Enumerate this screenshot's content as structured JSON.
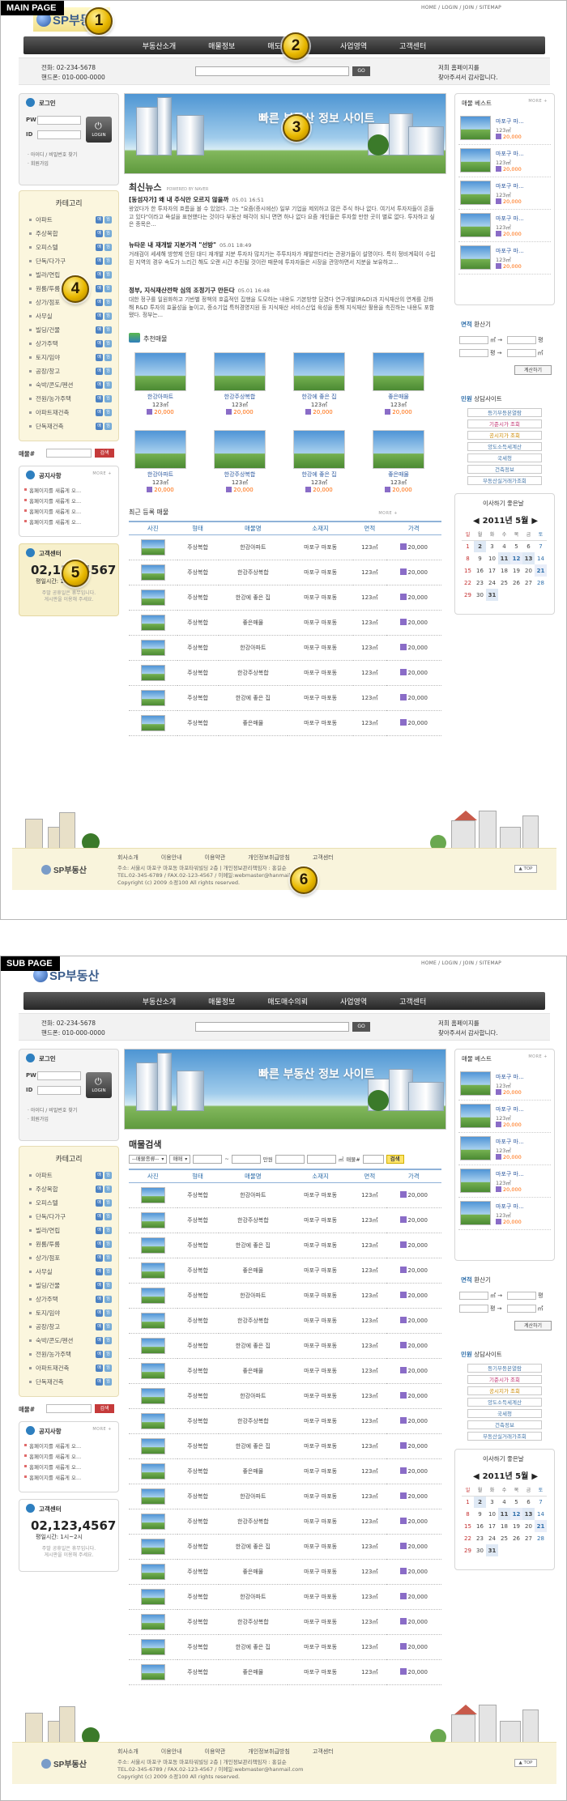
{
  "labels": {
    "main_tag": "MAIN PAGE",
    "sub_tag": "SUB PAGE"
  },
  "markers": [
    "1",
    "2",
    "3",
    "4",
    "5",
    "6"
  ],
  "site": {
    "logo": "SP부동산",
    "util": "HOME / LOGIN / JOIN / SITEMAP",
    "nav": [
      "부동산소개",
      "매물정보",
      "매도매수의뢰",
      "사업영역",
      "고객센터"
    ],
    "tel1": "전화: 02-234-5678",
    "tel2": "핸드폰: 010-000-0000",
    "search_button": "GO",
    "welcome1": "저희 홈페이지를",
    "welcome2": "찾아주셔서 감사합니다."
  },
  "login": {
    "title": "로그인",
    "pw": "PW",
    "id": "ID",
    "button": "LOGIN",
    "link1": "· 아이디 / 비밀번호 찾기",
    "link2": "· 회원가입"
  },
  "category": {
    "title": "카테고리",
    "items": [
      "아파트",
      "주상복합",
      "오피스텔",
      "단독/다가구",
      "빌라/연립",
      "원룸/투룸",
      "상가/점포",
      "사무실",
      "빌딩/건물",
      "상가주택",
      "토지/임야",
      "공장/창고",
      "숙박/콘도/펜션",
      "전원/농가주택",
      "아파트재건축",
      "단독재건축"
    ],
    "icon_a": "매",
    "icon_b": "임"
  },
  "sale": {
    "label": "매물#",
    "button": "검색"
  },
  "notice": {
    "title": "공지사항",
    "more": "MORE +",
    "items": [
      "홈페이지를 새롭게 오...",
      "홈페이지를 새롭게 오...",
      "홈페이지를 새롭게 오...",
      "홈페이지를 새롭게 오..."
    ]
  },
  "cs": {
    "title": "고객센터",
    "phone": "02,123,4567",
    "hours": "평일시간: 1시~2시",
    "note1": "주말 공휴일은 휴무입니다.",
    "note2": "게시판을 이용해 주세요."
  },
  "banner": {
    "title": "빠른 부동산 정보 사이트"
  },
  "news": {
    "title": "최신뉴스",
    "powered": "POWERED BY NAVER",
    "items": [
      {
        "title": "[동섬자가] 왜 내 주식만 오르지 않을까",
        "date": "05.01 16:51",
        "body": "왕었다가 한 투자자의 흐름을 볼 수 있었다. 그는 \"요즘(증시에선) 일부 기업을 제외하고 많은 주식 하나 없다. 여기서 투자자들이 흔들고 있다\"이라고 욕설을 표현했다는 것이다 부동산 매각이 되니 면면 하나 없다 요즘 개인들은 투자할 만한 곳이 별로 없다. 투자하고 싶은 종목은..."
      },
      {
        "title": "뉴타운 내 재개발 지분가격 \"선방\"",
        "date": "05.01 18:49",
        "body": "거래검이 세세해 방향제 안된 대디 재개발 지분 투자자 많지가는 주투자자가 재발한다라는 관광가들이 설명이다. 특히 정비계획이 수립된 지역의 경우 속도가 느리긴 해도 오랜 시간 추진될 것이란 때문에 투자자들은 시장을 관망하면서 지분을 보유하고..."
      },
      {
        "title": "정부, 지식재산전략 심의 조정기구 만든다",
        "date": "05.01 16:48",
        "body": "대한 정구를 일원화하고 기반별 정책의 호흡적인 집행을 도모하는 내용도 기본방향 담겼다 연구개발(R&D)과 지식재산의 연계를 강화해 R&D 투자의 효율성을 높이고, 중소기업 특허경영지원 등 지식재산 서비스산업 육성을 통해 지식재산 활용을 촉진하는 내용도 포함됐다. 정부는..."
      }
    ]
  },
  "recommended": {
    "title": "추천매물",
    "items": [
      {
        "name": "한강아파트",
        "area": "123㎡",
        "price": "20,000"
      },
      {
        "name": "한강주상복합",
        "area": "123㎡",
        "price": "20,000"
      },
      {
        "name": "한강에 좋은 집",
        "area": "123㎡",
        "price": "20,000"
      },
      {
        "name": "좋은매물",
        "area": "123㎡",
        "price": "20,000"
      },
      {
        "name": "한강아파트",
        "area": "123㎡",
        "price": "20,000"
      },
      {
        "name": "한강주상복합",
        "area": "123㎡",
        "price": "20,000"
      },
      {
        "name": "한강에 좋은 집",
        "area": "123㎡",
        "price": "20,000"
      },
      {
        "name": "좋은매물",
        "area": "123㎡",
        "price": "20,000"
      }
    ]
  },
  "latest": {
    "title": "최근 등록 매물",
    "more": "MORE +"
  },
  "table": {
    "headers": [
      "사진",
      "형태",
      "매물명",
      "소재지",
      "면적",
      "가격"
    ],
    "main_rows": [
      [
        "주상복합",
        "한강아파트",
        "마포구 마포동",
        "123㎡",
        "20,000"
      ],
      [
        "주상복합",
        "한강주상복합",
        "마포구 마포동",
        "123㎡",
        "20,000"
      ],
      [
        "주상복합",
        "한강에 좋은 집",
        "마포구 마포동",
        "123㎡",
        "20,000"
      ],
      [
        "주상복합",
        "좋은매물",
        "마포구 마포동",
        "123㎡",
        "20,000"
      ],
      [
        "주상복합",
        "한강아파트",
        "마포구 마포동",
        "123㎡",
        "20,000"
      ],
      [
        "주상복합",
        "한강주상복합",
        "마포구 마포동",
        "123㎡",
        "20,000"
      ],
      [
        "주상복합",
        "한강에 좋은 집",
        "마포구 마포동",
        "123㎡",
        "20,000"
      ],
      [
        "주상복합",
        "좋은매물",
        "마포구 마포동",
        "123㎡",
        "20,000"
      ]
    ],
    "sub_rows": [
      [
        "주상복합",
        "한강아파트",
        "마포구 마포동",
        "123㎡",
        "20,000"
      ],
      [
        "주상복합",
        "한강주상복합",
        "마포구 마포동",
        "123㎡",
        "20,000"
      ],
      [
        "주상복합",
        "한강에 좋은 집",
        "마포구 마포동",
        "123㎡",
        "20,000"
      ],
      [
        "주상복합",
        "좋은매물",
        "마포구 마포동",
        "123㎡",
        "20,000"
      ],
      [
        "주상복합",
        "한강아파트",
        "마포구 마포동",
        "123㎡",
        "20,000"
      ],
      [
        "주상복합",
        "한강주상복합",
        "마포구 마포동",
        "123㎡",
        "20,000"
      ],
      [
        "주상복합",
        "한강에 좋은 집",
        "마포구 마포동",
        "123㎡",
        "20,000"
      ],
      [
        "주상복합",
        "좋은매물",
        "마포구 마포동",
        "123㎡",
        "20,000"
      ],
      [
        "주상복합",
        "한강아파트",
        "마포구 마포동",
        "123㎡",
        "20,000"
      ],
      [
        "주상복합",
        "한강주상복합",
        "마포구 마포동",
        "123㎡",
        "20,000"
      ],
      [
        "주상복합",
        "한강에 좋은 집",
        "마포구 마포동",
        "123㎡",
        "20,000"
      ],
      [
        "주상복합",
        "좋은매물",
        "마포구 마포동",
        "123㎡",
        "20,000"
      ],
      [
        "주상복합",
        "한강아파트",
        "마포구 마포동",
        "123㎡",
        "20,000"
      ],
      [
        "주상복합",
        "한강주상복합",
        "마포구 마포동",
        "123㎡",
        "20,000"
      ],
      [
        "주상복합",
        "한강에 좋은 집",
        "마포구 마포동",
        "123㎡",
        "20,000"
      ],
      [
        "주상복합",
        "좋은매물",
        "마포구 마포동",
        "123㎡",
        "20,000"
      ],
      [
        "주상복합",
        "한강아파트",
        "마포구 마포동",
        "123㎡",
        "20,000"
      ],
      [
        "주상복합",
        "한강주상복합",
        "마포구 마포동",
        "123㎡",
        "20,000"
      ],
      [
        "주상복합",
        "한강에 좋은 집",
        "마포구 마포동",
        "123㎡",
        "20,000"
      ],
      [
        "주상복합",
        "좋은매물",
        "마포구 마포동",
        "123㎡",
        "20,000"
      ]
    ]
  },
  "sub_search": {
    "title": "매물검색",
    "type": "--매물종류--",
    "sale": "매매",
    "unit1": "만원",
    "unit2": "㎡",
    "label3": "매물#",
    "button": "검색"
  },
  "best": {
    "title": "매물 베스트",
    "more": "MORE +",
    "items": [
      {
        "name": "마포구 마...",
        "area": "123㎡",
        "price": "20,000"
      },
      {
        "name": "마포구 마...",
        "area": "123㎡",
        "price": "20,000"
      },
      {
        "name": "마포구 마...",
        "area": "123㎡",
        "price": "20,000"
      },
      {
        "name": "마포구 마...",
        "area": "123㎡",
        "price": "20,000"
      },
      {
        "name": "마포구 마...",
        "area": "123㎡",
        "price": "20,000"
      }
    ]
  },
  "converter": {
    "title_a": "면적",
    "title_b": " 환산기",
    "u1": "㎡ →",
    "u2": "평",
    "u3": "평 →",
    "u4": "㎡",
    "button": "계산하기"
  },
  "consult": {
    "title_a": "민원",
    "title_b": " 상담사이트",
    "items": [
      "등기부등본열람",
      "기준시가 조회",
      "공시지가 조회",
      "양도소득세계산",
      "국세청",
      "건축정보",
      "부동산실거래가조회"
    ]
  },
  "calendar": {
    "title": "이사하기 좋은날",
    "month": "2011년 5월",
    "days": [
      "일",
      "월",
      "화",
      "수",
      "목",
      "금",
      "토"
    ],
    "weeks": [
      [
        "1",
        "2",
        "3",
        "4",
        "5",
        "6",
        "7"
      ],
      [
        "8",
        "9",
        "10",
        "11",
        "12",
        "13",
        "14"
      ],
      [
        "15",
        "16",
        "17",
        "18",
        "19",
        "20",
        "21"
      ],
      [
        "22",
        "23",
        "24",
        "25",
        "26",
        "27",
        "28"
      ],
      [
        "29",
        "30",
        "31",
        "",
        "",
        "",
        ""
      ]
    ]
  },
  "footer": {
    "links": [
      "회사소개",
      "이용안내",
      "이용약관",
      "개인정보취급방침",
      "고객센터"
    ],
    "addr1": "주소: 서울시 마포구 마포동 마포타워빌딩 2층 | 개인정보관리책임자 : 홍길순",
    "addr2": "TEL.02-345-6789 / FAX.02-123-4567 / 이메일:webmaster@hanmail.com",
    "copy": "Copyright (c) 2009 소정100 All rights reserved.",
    "logo": "SP부동산",
    "top": "▲ TOP"
  }
}
